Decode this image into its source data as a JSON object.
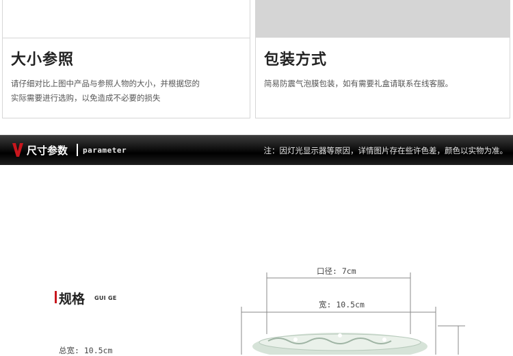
{
  "cards": {
    "left": {
      "title": "大小参照",
      "line1": "请仔细对比上图中产品与参照人物的大小，并根据您的",
      "line2": "实际需要进行选购，以免造成不必要的损失"
    },
    "right": {
      "title": "包装方式",
      "line1": "简易防震气泡膜包装，如有需要礼盒请联系在线客服。"
    }
  },
  "banner": {
    "title": "尺寸参数",
    "subtitle": "parameter",
    "note": "注：因灯光显示器等原因，详情图片存在些许色差，颜色以实物为准。",
    "accent_color": "#c8161d"
  },
  "spec": {
    "label_zh": "规格",
    "label_en": "GUI GE",
    "total_width": "总宽: 10.5cm"
  },
  "diagram": {
    "mouth_diameter": "口径: 7cm",
    "width": "宽: 10.5cm",
    "product_icon": "ceramic-bowl-image"
  }
}
